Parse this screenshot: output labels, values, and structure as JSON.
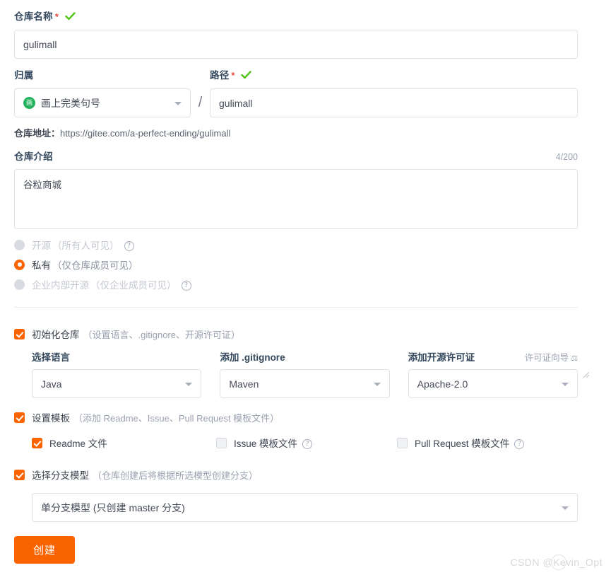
{
  "form": {
    "name_field": {
      "label": "仓库名称",
      "required_mark": "*",
      "valid_icon": "check-icon",
      "value": "gulimall"
    },
    "owner_field": {
      "label": "归属",
      "avatar_char": "画",
      "avatar_color": "#24b35e",
      "value": "画上完美句号"
    },
    "separator": "/",
    "path_field": {
      "label": "路径",
      "required_mark": "*",
      "valid_icon": "check-icon",
      "value": "gulimall"
    },
    "repo_address": {
      "label": "仓库地址：",
      "url": "https://gitee.com/a-perfect-ending/gulimall"
    },
    "description_field": {
      "label": "仓库介绍",
      "counter": "4/200",
      "value": "谷粒商城"
    },
    "visibility": {
      "options": [
        {
          "label": "开源",
          "hint": "（所有人可见）",
          "selected": false,
          "disabled": true,
          "help_icon": "question-mark-icon"
        },
        {
          "label": "私有",
          "hint": "（仅仓库成员可见）",
          "selected": true,
          "disabled": false,
          "help_icon": ""
        },
        {
          "label": "企业内部开源",
          "hint": "（仅企业成员可见）",
          "selected": false,
          "disabled": true,
          "help_icon": "question-mark-icon"
        }
      ]
    },
    "init_section": {
      "checkbox_checked": true,
      "label": "初始化仓库",
      "hint": "（设置语言、.gitignore、开源许可证）",
      "columns": [
        {
          "title": "选择语言",
          "value": "Java",
          "link": ""
        },
        {
          "title": "添加 .gitignore",
          "value": "Maven",
          "link": ""
        },
        {
          "title": "添加开源许可证",
          "value": "Apache-2.0",
          "link": "许可证向导"
        }
      ]
    },
    "template_section": {
      "checkbox_checked": true,
      "label": "设置模板",
      "hint": "（添加 Readme、Issue、Pull Request 模板文件）",
      "items": [
        {
          "label": "Readme 文件",
          "checked": true,
          "help_icon": ""
        },
        {
          "label": "Issue 模板文件",
          "checked": false,
          "help_icon": "question-mark-icon"
        },
        {
          "label": "Pull Request 模板文件",
          "checked": false,
          "help_icon": "question-mark-icon"
        }
      ]
    },
    "branch_section": {
      "checkbox_checked": true,
      "label": "选择分支模型",
      "hint": "（仓库创建后将根据所选模型创建分支）",
      "value": "单分支模型 (只创建 master 分支)"
    },
    "submit_button": "创建"
  },
  "watermark": "CSDN @Kevin_Opt",
  "colors": {
    "accent": "#fa6400",
    "success": "#52c41a",
    "required": "#e74c3c",
    "avatar": "#24b35e",
    "border": "#dfe1e8"
  }
}
